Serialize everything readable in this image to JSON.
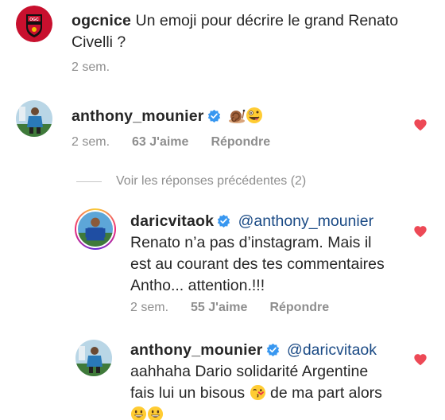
{
  "comments": [
    {
      "username": "ogcnice",
      "text": "Un emoji pour décrire le grand Renato Civelli ?",
      "time": "2 sem.",
      "avatar": "ogc-nice-crest-logo"
    },
    {
      "username": "anthony_mounier",
      "verified": true,
      "text": "",
      "emojis": [
        "snail-emoji",
        "zany-face-emoji"
      ],
      "time": "2 sem.",
      "likes": "63 J'aime",
      "reply": "Répondre",
      "liked": true
    }
  ],
  "view_previous": "Voir les réponses précédentes (2)",
  "replies": [
    {
      "username": "daricvitaok",
      "verified": true,
      "mention": "@anthony_mounier",
      "lines": [
        "Renato n’a pas d’instagram.  Mais il",
        "est au courant des tes commentaires",
        "Antho... attention.!!!"
      ],
      "time": "2 sem.",
      "likes": "55 J'aime",
      "reply": "Répondre",
      "liked": true
    },
    {
      "username": "anthony_mounier",
      "verified": true,
      "mention": "@daricvitaok",
      "lines": [
        "aahhaha Dario solidarité Argentine",
        "fais lui un bisous",
        "de ma part alors"
      ],
      "emojis": [
        "kiss-face-emoji",
        "grin-face-emoji",
        "grin-face-emoji"
      ],
      "liked": true
    }
  ],
  "colors": {
    "heart": "#ed4956",
    "verified": "#3897f0",
    "meta": "#8e8e8e",
    "text": "#262626",
    "mention": "#1a4a85"
  }
}
